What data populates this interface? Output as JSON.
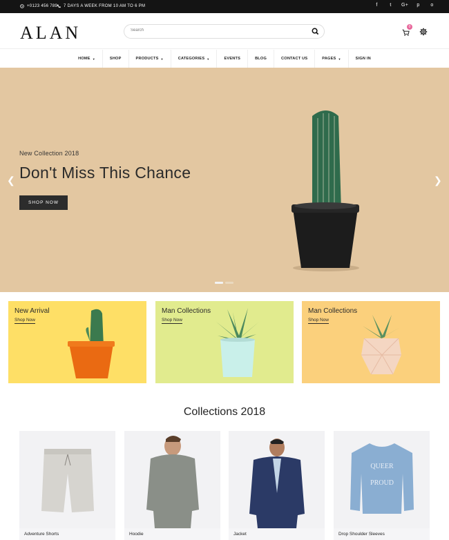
{
  "topbar": {
    "phone": "+0123 456 789",
    "hours": "7 DAYS A WEEK FROM 10 AM TO 6 PM",
    "social_icons": [
      "facebook-icon",
      "twitter-icon",
      "google-plus-icon",
      "pinterest-icon",
      "instagram-icon"
    ],
    "social_glyphs": [
      "f",
      "t",
      "G+",
      "p",
      "o"
    ]
  },
  "header": {
    "logo": "ALAN",
    "search_placeholder": "Search",
    "cart_count": "0"
  },
  "nav": {
    "items": [
      {
        "label": "HOME",
        "dropdown": true
      },
      {
        "label": "SHOP",
        "dropdown": false
      },
      {
        "label": "PRODUCTS",
        "dropdown": true
      },
      {
        "label": "CATEGORIES",
        "dropdown": true
      },
      {
        "label": "EVENTS",
        "dropdown": false
      },
      {
        "label": "BLOG",
        "dropdown": false
      },
      {
        "label": "CONTACT US",
        "dropdown": false
      },
      {
        "label": "PAGES",
        "dropdown": true
      },
      {
        "label": "SIGN IN",
        "dropdown": false
      }
    ]
  },
  "hero": {
    "subtitle": "New Collection 2018",
    "title": "Don't Miss This Chance",
    "button": "SHOP NOW",
    "slide_count": 2,
    "active_slide": 1
  },
  "banners": [
    {
      "title": "New Arrival",
      "link": "Shop Now",
      "bg": "#fedf66"
    },
    {
      "title": "Man Collections",
      "link": "Shop Now",
      "bg": "#e1eb8e"
    },
    {
      "title": "Man Collections",
      "link": "Shop Now",
      "bg": "#fbd07c"
    }
  ],
  "collections": {
    "title": "Collections 2018",
    "products": [
      {
        "name": "Adventure Shorts"
      },
      {
        "name": "Hoodie"
      },
      {
        "name": "Jacket"
      },
      {
        "name": "Drop Shoulder Sleeves"
      }
    ]
  },
  "colors": {
    "topbar_bg": "#141414",
    "hero_bg": "#e3c7a1",
    "badge": "#e8679b",
    "button": "#2c2c2c"
  }
}
